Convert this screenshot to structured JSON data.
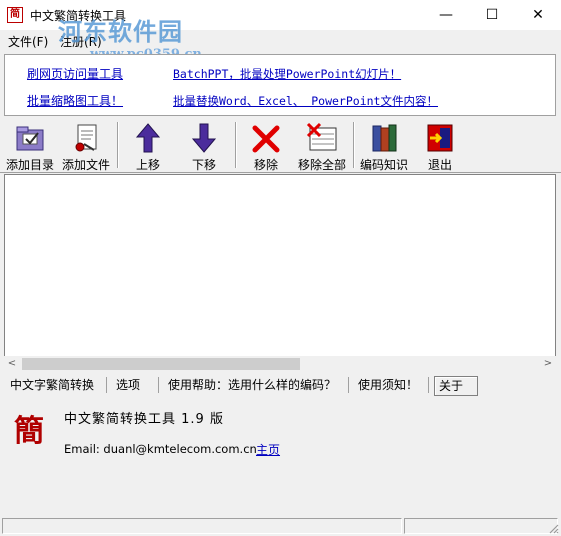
{
  "window": {
    "title": "中文繁简转换工具",
    "app_icon_glyph": "简",
    "minimize_glyph": "—",
    "maximize_glyph": "☐",
    "close_glyph": "✕"
  },
  "watermark": {
    "text": "河东软件园",
    "url": "www.pc0359.cn"
  },
  "menu": {
    "file": "文件(F)",
    "register": "注册(R)"
  },
  "links": {
    "l1": "刷网页访问量工具",
    "l2": "BatchPPT，批量处理PowerPoint幻灯片！",
    "l3": "批量缩略图工具！",
    "l4": "批量替换Word、Excel、 PowerPoint文件内容！"
  },
  "toolbar": {
    "add_dir": "添加目录",
    "add_file": "添加文件",
    "move_up": "上移",
    "move_down": "下移",
    "remove": "移除",
    "remove_all": "移除全部",
    "encoding": "编码知识",
    "exit": "退出"
  },
  "scrollbar": {
    "left": "<",
    "right": ">"
  },
  "tabs": {
    "convert": "中文字繁简转换",
    "options": "选项",
    "help": "使用帮助：选用什么样的编码？",
    "notice": "使用须知！",
    "about": "关于"
  },
  "about": {
    "icon_char": "簡",
    "title": "中文繁简转换工具 1.9 版",
    "email": "Email: duanl@kmtelecom.com.cn",
    "home": "主页"
  },
  "colors": {
    "link": "#0000c0",
    "accent_red": "#b00000",
    "arrow_purple": "#4b2c9c"
  }
}
